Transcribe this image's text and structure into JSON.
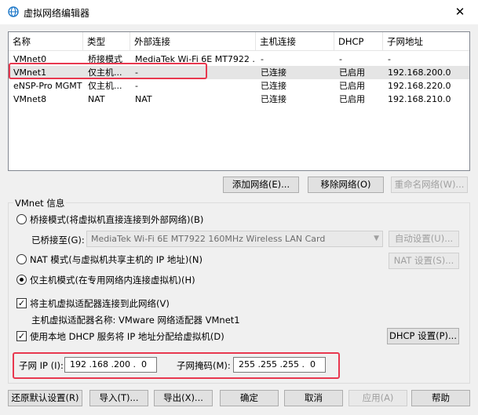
{
  "window": {
    "title": "虚拟网络编辑器",
    "close": "✕"
  },
  "table": {
    "headers": [
      "名称",
      "类型",
      "外部连接",
      "主机连接",
      "DHCP",
      "子网地址"
    ],
    "rows": [
      [
        "VMnet0",
        "桥接模式",
        "MediaTek Wi-Fi 6E MT7922 ...",
        "-",
        "-",
        "-"
      ],
      [
        "VMnet1",
        "仅主机...",
        "-",
        "已连接",
        "已启用",
        "192.168.200.0"
      ],
      [
        "eNSP-Pro MGMT",
        "仅主机...",
        "-",
        "已连接",
        "已启用",
        "192.168.220.0"
      ],
      [
        "VMnet8",
        "NAT",
        "NAT",
        "已连接",
        "已启用",
        "192.168.210.0"
      ]
    ]
  },
  "net_buttons": {
    "add": "添加网络(E)...",
    "remove": "移除网络(O)",
    "rename": "重命名网络(W)..."
  },
  "vmnet_info": {
    "legend": "VMnet 信息",
    "bridge_radio": "桥接模式(将虚拟机直接连接到外部网络)(B)",
    "bridged_to_label": "已桥接至(G):",
    "bridged_to_value": "MediaTek Wi-Fi 6E MT7922 160MHz Wireless LAN Card",
    "auto_settings": "自动设置(U)...",
    "nat_radio": "NAT 模式(与虚拟机共享主机的 IP 地址)(N)",
    "nat_settings": "NAT 设置(S)...",
    "hostonly_radio": "仅主机模式(在专用网络内连接虚拟机)(H)",
    "connect_adapter_check": "将主机虚拟适配器连接到此网络(V)",
    "adapter_name": "主机虚拟适配器名称: VMware 网络适配器 VMnet1",
    "dhcp_check": "使用本地 DHCP 服务将 IP 地址分配给虚拟机(D)",
    "dhcp_settings": "DHCP 设置(P)...",
    "subnet_ip_label": "子网 IP (I):",
    "subnet_ip_value": "192 .168 .200 .  0",
    "subnet_mask_label": "子网掩码(M):",
    "subnet_mask_value": "255 .255 .255 .  0"
  },
  "footer": {
    "restore": "还原默认设置(R)",
    "import": "导入(T)...",
    "export": "导出(X)...",
    "ok": "确定",
    "cancel": "取消",
    "apply": "应用(A)",
    "help": "帮助"
  },
  "colors": {
    "highlight": "#e8384f",
    "selected_row": "#e5e5e5"
  }
}
